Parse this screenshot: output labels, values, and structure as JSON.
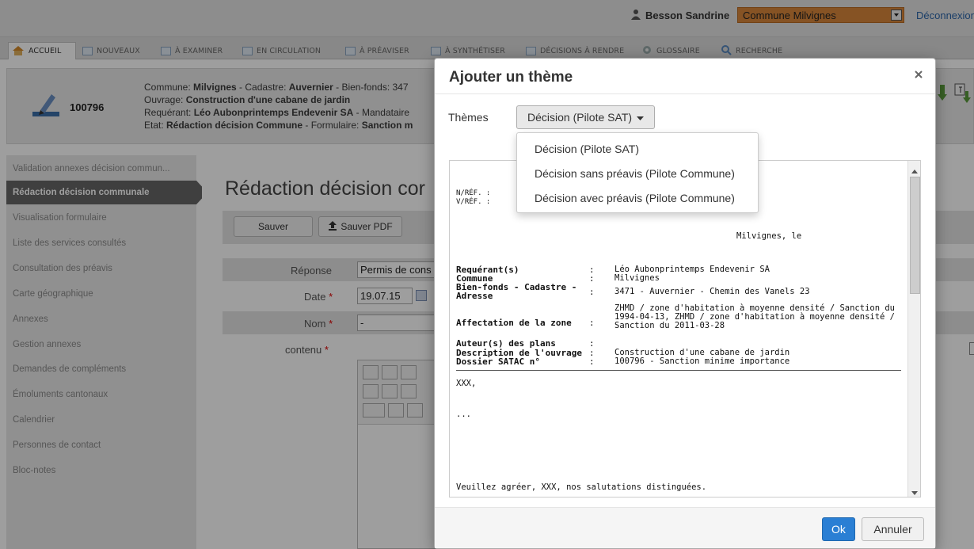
{
  "header": {
    "user_name": "Besson Sandrine",
    "commune_select": "Commune Milvignes",
    "logout": "Déconnexion",
    "accent": "#d9863a"
  },
  "tabs": [
    {
      "label": "ACCUEIL",
      "icon": "home-icon"
    },
    {
      "label": "NOUVEAUX",
      "icon": "folder-icon"
    },
    {
      "label": "À EXAMINER",
      "icon": "folder-icon"
    },
    {
      "label": "EN CIRCULATION",
      "icon": "folder-icon"
    },
    {
      "label": "À PRÉAVISER",
      "icon": "folder-icon"
    },
    {
      "label": "À SYNTHÉTISER",
      "icon": "folder-icon"
    },
    {
      "label": "DÉCISIONS À RENDRE",
      "icon": "folder-icon"
    },
    {
      "label": "GLOSSAIRE",
      "icon": "gear-icon"
    },
    {
      "label": "RECHERCHE",
      "icon": "search-icon"
    }
  ],
  "dossier": {
    "number": "100796",
    "line1_label": "Commune: ",
    "line1_commune": "Milvignes",
    "line1_mid": " - Cadastre: ",
    "line1_cadastre": "Auvernier",
    "line1_tail": " - Bien-fonds: 347",
    "line2_label": "Ouvrage: ",
    "line2_value": "Construction d'une cabane de jardin",
    "line3_label": "Requérant: ",
    "line3_value": "Léo Aubonprintemps Endevenir SA",
    "line3_tail": " - Mandataire",
    "line4_label": "Etat: ",
    "line4_value": "Rédaction décision Commune",
    "line4_mid": " - Formulaire: ",
    "line4_tail": "Sanction m"
  },
  "sidebar": {
    "items": [
      "Validation annexes décision commun...",
      "Rédaction décision communale",
      "Visualisation formulaire",
      "Liste des services consultés",
      "Consultation des préavis",
      "Carte géographique",
      "Annexes",
      "Gestion annexes",
      "Demandes de compléments",
      "Émoluments cantonaux",
      "Calendrier",
      "Personnes de contact",
      "Bloc-notes"
    ]
  },
  "main": {
    "title": "Rédaction décision cor",
    "save_button": "Sauver",
    "save_pdf_button": "Sauver PDF",
    "reponse_label": "Réponse",
    "reponse_value": "Permis de cons",
    "date_label": "Date",
    "date_value": "19.07.15",
    "nom_label": "Nom",
    "nom_value": "-",
    "contenu_label": "contenu",
    "required_mark": "*"
  },
  "modal": {
    "title": "Ajouter un thème",
    "themes_label": "Thèmes",
    "themes_selected": "Décision (Pilote SAT)",
    "options": [
      "Décision (Pilote SAT)",
      "Décision sans préavis (Pilote Commune)",
      "Décision avec préavis (Pilote Commune)"
    ],
    "doc": {
      "nref": "N/RÉF. :",
      "vref": "V/RÉF. :",
      "place_date": "Milvignes, le",
      "fields": [
        {
          "label": "Requérant(s)",
          "value": "Léo Aubonprintemps Endevenir SA"
        },
        {
          "label": "Commune",
          "value": "Milvignes"
        },
        {
          "label": "Bien-fonds - Cadastre -",
          "label2": "Adresse",
          "value": "3471 - Auvernier - Chemin des Vanels 23"
        },
        {
          "label": "Affectation de la zone",
          "value": "ZHMD / zone d'habitation à moyenne densité / Sanction du",
          "value2": "1994-04-13, ZHMD / zone d'habitation à moyenne densité /",
          "value3": "Sanction du 2011-03-28"
        },
        {
          "label": "Auteur(s) des plans",
          "value": ""
        },
        {
          "label": "Description de l'ouvrage",
          "value": "Construction d'une cabane de jardin"
        },
        {
          "label": "Dossier SATAC n°",
          "value": "100796 - Sanction minime importance"
        }
      ],
      "greeting": "XXX,",
      "ellipsis": "...",
      "closing": "Veuillez agréer, XXX, nos salutations distinguées."
    },
    "ok": "Ok",
    "cancel": "Annuler",
    "ok_color": "#2a7fd4"
  }
}
